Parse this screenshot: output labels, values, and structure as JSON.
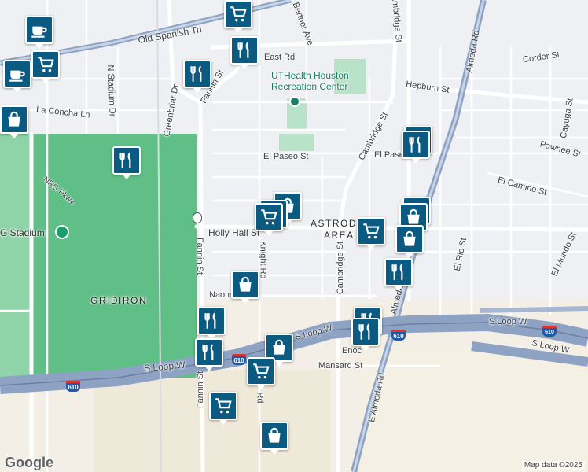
{
  "map": {
    "streets": [
      {
        "id": "old-spanish-trl",
        "label": "Old Spanish Trl"
      },
      {
        "id": "east-rd",
        "label": "East Rd"
      },
      {
        "id": "bertner-ave",
        "label": "Bertner Ave"
      },
      {
        "id": "cambridge-st-north",
        "label": "Cambridge St"
      },
      {
        "id": "almeda-rd-north",
        "label": "Almeda Rd"
      },
      {
        "id": "corder-st",
        "label": "Corder St"
      },
      {
        "id": "hepburn-st",
        "label": "Hepburn St"
      },
      {
        "id": "fannin-st-north",
        "label": "Fannin St"
      },
      {
        "id": "greenbriar-dr",
        "label": "Greenbriar Dr"
      },
      {
        "id": "n-stadium-dr",
        "label": "N Stadium Dr"
      },
      {
        "id": "la-concha-ln",
        "label": "La Concha Ln"
      },
      {
        "id": "cayuga-st",
        "label": "Cayuga St"
      },
      {
        "id": "pawnee-st",
        "label": "Pawnee St"
      },
      {
        "id": "el-paseo-st",
        "label": "El Paseo St"
      },
      {
        "id": "el-paseo-st-east",
        "label": "El Paseo"
      },
      {
        "id": "cambridge-st-mid",
        "label": "Cambridge St"
      },
      {
        "id": "el-camino-st",
        "label": "El Camino St"
      },
      {
        "id": "nrg-pkwy",
        "label": "NRG Pkwy"
      },
      {
        "id": "holly-hall-st",
        "label": "Holly Hall St"
      },
      {
        "id": "fannin-st-south",
        "label": "Fannin St"
      },
      {
        "id": "knight-rd",
        "label": "Knight Rd"
      },
      {
        "id": "cambridge-st-south",
        "label": "Cambridge St"
      },
      {
        "id": "el-rio-st",
        "label": "El Rio St"
      },
      {
        "id": "el-mundo-st",
        "label": "El Mundo St"
      },
      {
        "id": "naomi",
        "label": "Naom"
      },
      {
        "id": "almeda-rd-south",
        "label": "Almeda"
      },
      {
        "id": "s-loop-w-east",
        "label": "S Loop W"
      },
      {
        "id": "s-loop-w-east2",
        "label": "S Loop W"
      },
      {
        "id": "s-loop-w-mid",
        "label": "S Loop W"
      },
      {
        "id": "s-loop-w-west",
        "label": "S Loop W"
      },
      {
        "id": "enoch",
        "label": "Enoc"
      },
      {
        "id": "mansard-st",
        "label": "Mansard St"
      },
      {
        "id": "e-almeda-rd",
        "label": "E Almeda Rd"
      },
      {
        "id": "fannin-st-bottom",
        "label": "Fannin St"
      },
      {
        "id": "rd-bottom",
        "label": "Rd"
      }
    ],
    "areas": {
      "astrodome_line1": "ASTRODO",
      "astrodome_line2": "AREA",
      "gridiron": "GRIDIRON",
      "stadium": "G Stadium"
    },
    "poi": {
      "line1": "UTHealth Houston",
      "line2": "Recreation Center"
    },
    "highway_shields": [
      "610",
      "610",
      "610"
    ],
    "pins": [
      {
        "id": "pin-1",
        "type": "shopping-cart-icon"
      },
      {
        "id": "pin-2",
        "type": "coffee-cup-icon"
      },
      {
        "id": "pin-3",
        "type": "coffee-cup-icon"
      },
      {
        "id": "pin-4",
        "type": "shopping-cart-icon"
      },
      {
        "id": "pin-5",
        "type": "shopping-bag-icon"
      },
      {
        "id": "pin-6",
        "type": "restaurant-icon"
      },
      {
        "id": "pin-7",
        "type": "shopping-cart-icon"
      },
      {
        "id": "pin-8",
        "type": "restaurant-icon"
      },
      {
        "id": "pin-9",
        "type": "restaurant-icon"
      },
      {
        "id": "pin-10",
        "type": "restaurant-icon"
      },
      {
        "id": "pin-11",
        "type": "shopping-bag-icon"
      },
      {
        "id": "pin-12",
        "type": "shopping-cart-icon"
      },
      {
        "id": "pin-13",
        "type": "shopping-cart-icon"
      },
      {
        "id": "pin-14",
        "type": "shopping-bag-icon"
      },
      {
        "id": "pin-15",
        "type": "shopping-bag-icon"
      },
      {
        "id": "pin-16",
        "type": "restaurant-icon"
      },
      {
        "id": "pin-17",
        "type": "shopping-bag-icon"
      },
      {
        "id": "pin-18",
        "type": "restaurant-icon"
      },
      {
        "id": "pin-19",
        "type": "restaurant-icon"
      },
      {
        "id": "pin-20",
        "type": "restaurant-icon"
      },
      {
        "id": "pin-21",
        "type": "shopping-bag-icon"
      },
      {
        "id": "pin-22",
        "type": "shopping-cart-icon"
      },
      {
        "id": "pin-23",
        "type": "shopping-cart-icon"
      },
      {
        "id": "pin-24",
        "type": "shopping-bag-icon"
      }
    ],
    "colors": {
      "pin": "#0a5a82",
      "park": "#b9e3c9",
      "highway": "#8ea3c4",
      "stadium_area": "#5fbf86"
    },
    "logo": "Google",
    "attribution": "Map data ©2025"
  }
}
